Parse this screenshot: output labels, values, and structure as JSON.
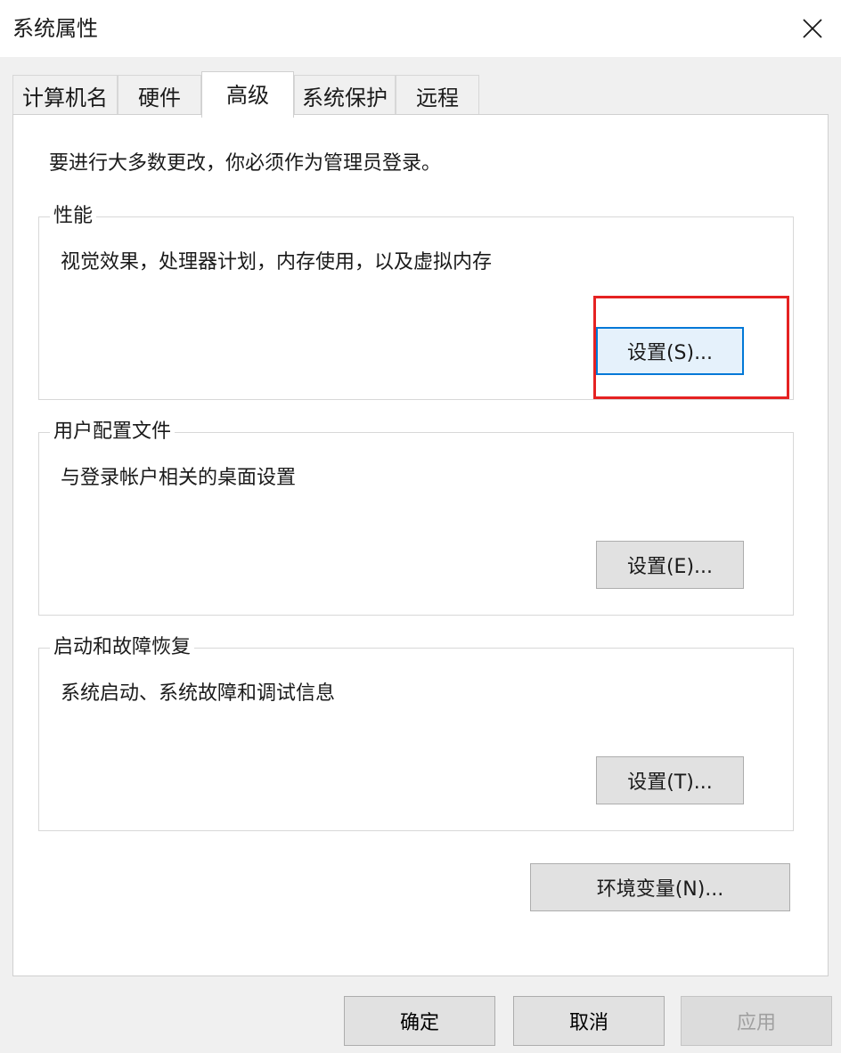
{
  "window": {
    "title": "系统属性",
    "close_icon": "close-icon"
  },
  "tabs": [
    {
      "label": "计算机名",
      "active": false
    },
    {
      "label": "硬件",
      "active": false
    },
    {
      "label": "高级",
      "active": true
    },
    {
      "label": "系统保护",
      "active": false
    },
    {
      "label": "远程",
      "active": false
    }
  ],
  "advanced": {
    "notice": "要进行大多数更改，你必须作为管理员登录。",
    "performance": {
      "title": "性能",
      "description": "视觉效果，处理器计划，内存使用，以及虚拟内存",
      "button": "设置(S)..."
    },
    "user_profiles": {
      "title": "用户配置文件",
      "description": "与登录帐户相关的桌面设置",
      "button": "设置(E)..."
    },
    "startup_recovery": {
      "title": "启动和故障恢复",
      "description": "系统启动、系统故障和调试信息",
      "button": "设置(T)..."
    },
    "env_button": "环境变量(N)..."
  },
  "footer": {
    "ok": "确定",
    "cancel": "取消",
    "apply": "应用"
  },
  "colors": {
    "highlight": "#e52222",
    "focus": "#0078d7"
  }
}
